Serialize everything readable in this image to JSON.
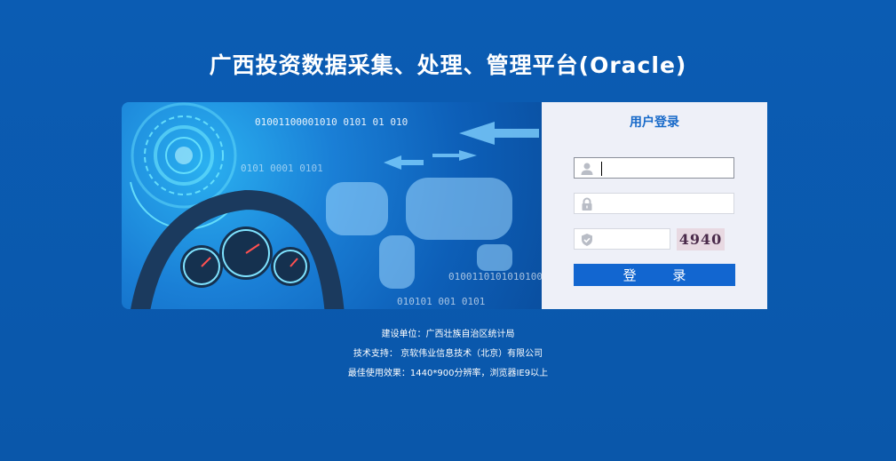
{
  "page": {
    "title": "广西投资数据采集、处理、管理平台(Oracle)"
  },
  "banner": {
    "binary_1": "01001100001010 0101 01 010",
    "binary_2": "0101 0001  0101",
    "binary_3": "0100110101010100",
    "binary_4": "010101 001 0101"
  },
  "login": {
    "title": "用户登录",
    "username": {
      "value": "",
      "placeholder": ""
    },
    "password": {
      "value": "",
      "placeholder": ""
    },
    "captcha": {
      "value": "",
      "placeholder": "",
      "code": "4940"
    },
    "submit_label": "登 录"
  },
  "footer": {
    "builder": "建设单位：广西壮族自治区统计局",
    "support": "技术支持： 京软伟业信息技术（北京）有限公司",
    "best_view": "最佳使用效果：1440*900分辨率，浏览器IE9以上"
  },
  "icons": {
    "user": "user-icon",
    "lock": "lock-icon",
    "shield": "shield-icon"
  },
  "colors": {
    "background": "#0a5ab0",
    "accent": "#1266d0",
    "title_blue": "#1769c9"
  }
}
